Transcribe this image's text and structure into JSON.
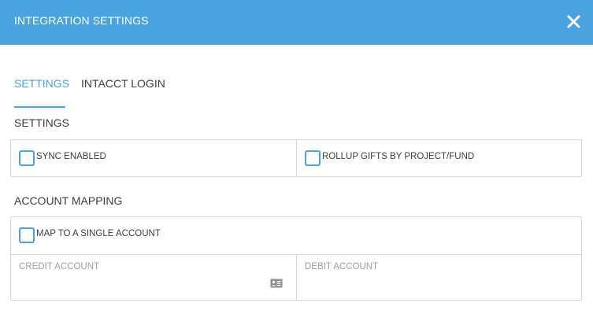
{
  "header": {
    "title": "INTEGRATION SETTINGS",
    "close_icon": "close-icon",
    "color": "#4aa3df"
  },
  "tabs": [
    {
      "label": "SETTINGS",
      "active": true
    },
    {
      "label": "INTACCT LOGIN",
      "active": false
    }
  ],
  "settings_section": {
    "title": "SETTINGS",
    "options": [
      {
        "label": "SYNC ENABLED",
        "checked": false
      },
      {
        "label": "ROLLUP GIFTS BY PROJECT/FUND",
        "checked": false
      }
    ]
  },
  "account_mapping": {
    "title": "ACCOUNT MAPPING",
    "single_account": {
      "label": "MAP TO A SINGLE ACCOUNT",
      "checked": false
    },
    "credit_account": {
      "label": "CREDIT ACCOUNT",
      "value": "",
      "icon": "contact-card-icon"
    },
    "debit_account": {
      "label": "DEBIT ACCOUNT",
      "value": ""
    }
  }
}
